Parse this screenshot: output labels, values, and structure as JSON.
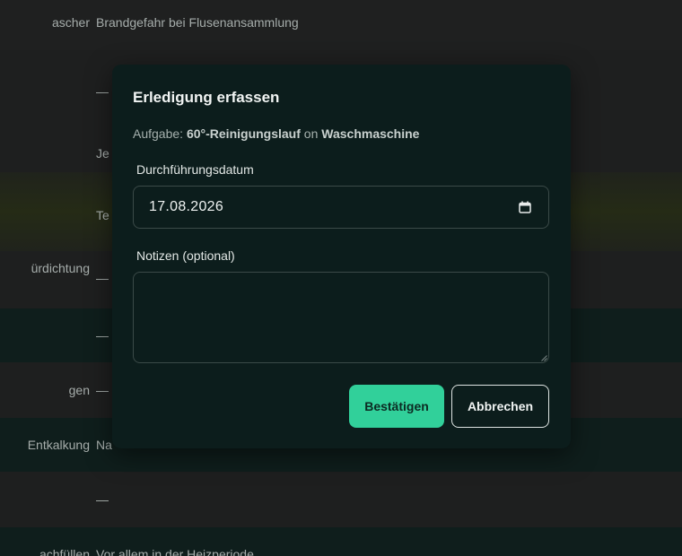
{
  "background_rows": [
    {
      "col1": "ascher",
      "col2": "Brandgefahr bei Flusenansammlung"
    },
    {
      "col1": "",
      "col2": "—"
    },
    {
      "col1": "",
      "col2": "Je"
    },
    {
      "col1": "",
      "col2": "Te"
    },
    {
      "col1": "ürdichtung",
      "col2": "—"
    },
    {
      "col1": "",
      "col2": "—"
    },
    {
      "col1": "gen",
      "col2": "—"
    },
    {
      "col1": "Entkalkung",
      "col2": "Na"
    },
    {
      "col1": "",
      "col2": "—"
    },
    {
      "col1": "achfüllen",
      "col2": "Vor allem in der Heizperiode"
    }
  ],
  "dialog": {
    "title": "Erledigung erfassen",
    "task_prefix": "Aufgabe:",
    "task_name": "60°-Reinigungslauf",
    "task_connector": "on",
    "device_name": "Waschmaschine",
    "date_label": "Durchführungsdatum",
    "date_value": "17.08.2026",
    "notes_label": "Notizen (optional)",
    "notes_value": "",
    "confirm_label": "Bestätigen",
    "cancel_label": "Abbrechen"
  },
  "colors": {
    "accent": "#31d09a",
    "dialog_bg": "#0c1d1c",
    "page_bg": "#1e1f1f"
  },
  "icons": {
    "date_picker": "calendar-icon"
  }
}
